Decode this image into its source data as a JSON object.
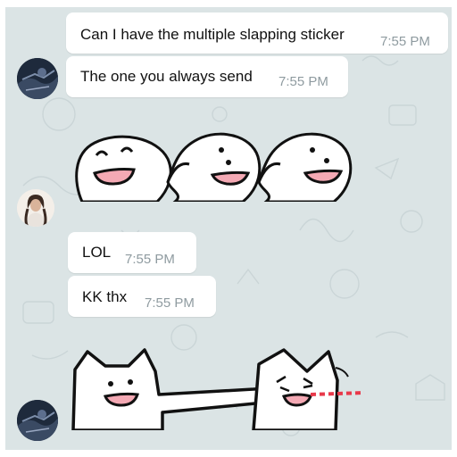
{
  "messages": [
    {
      "text": "Can I have the multiple slapping sticker",
      "time": "7:55 PM"
    },
    {
      "text": "The one you always send",
      "time": "7:55 PM"
    },
    {
      "text": "LOL",
      "time": "7:55 PM"
    },
    {
      "text": "KK thx",
      "time": "7:55 PM"
    }
  ],
  "stickers": [
    {
      "name": "three-laughing-blobs-sticker"
    },
    {
      "name": "cat-slapping-sticker"
    }
  ],
  "colors": {
    "chat_background": "#dbe4e5",
    "bubble": "#ffffff",
    "timestamp": "#8f9ba0",
    "sticker_mouth": "#f4a9b4",
    "tongue": "#e8394a"
  }
}
